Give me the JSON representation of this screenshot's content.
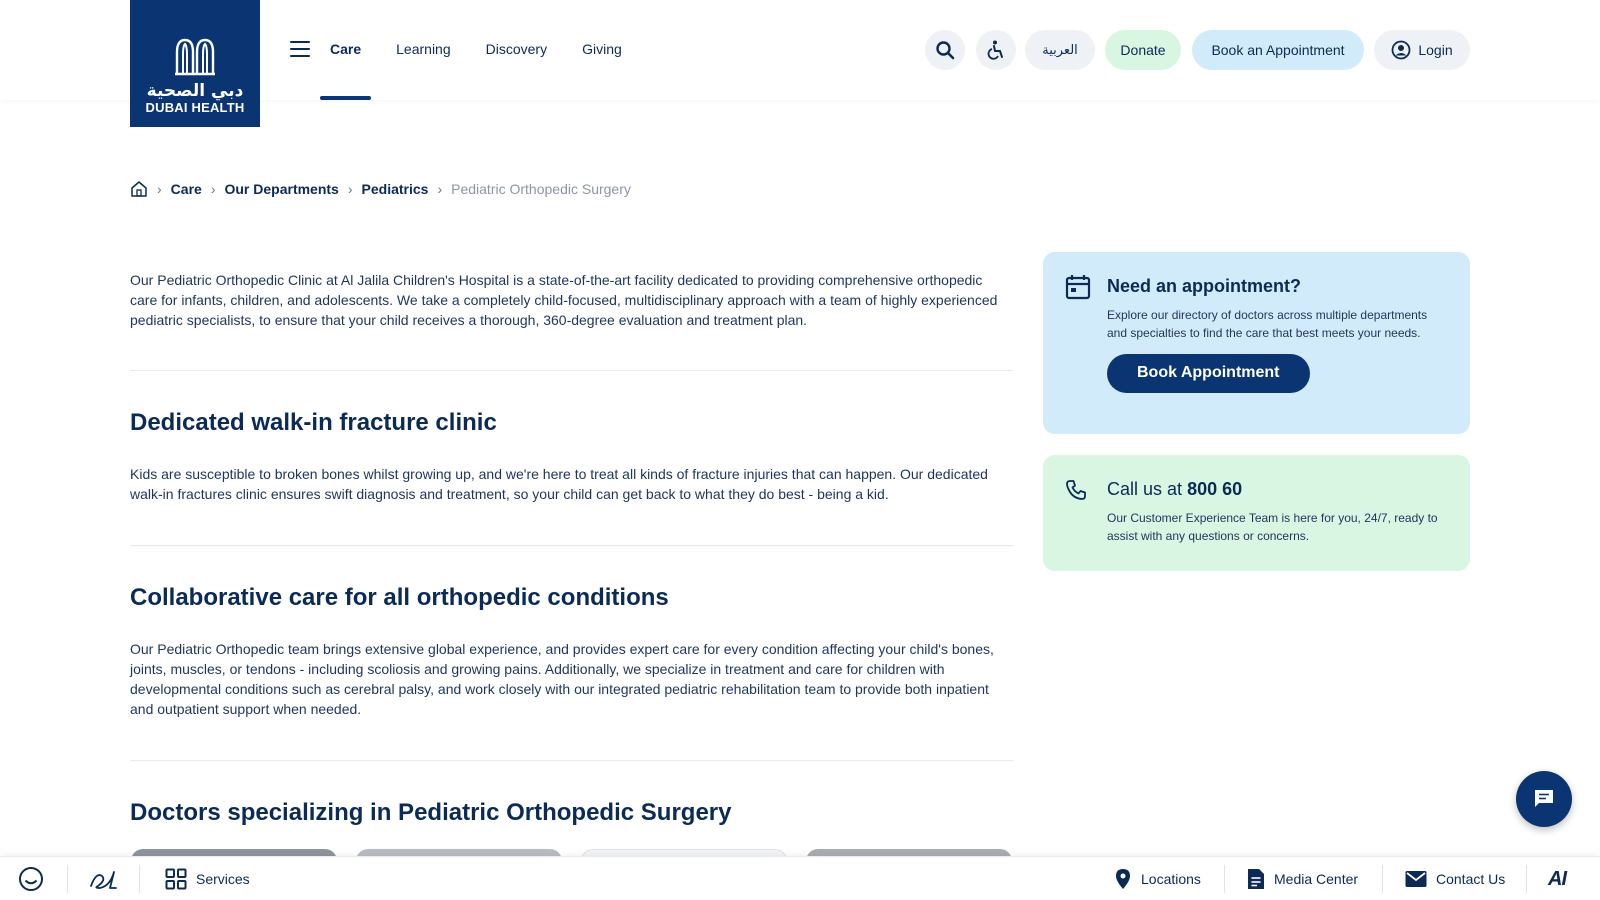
{
  "header": {
    "logo": {
      "arabic": "دبي الصحية",
      "english": "DUBAI HEALTH"
    },
    "nav": [
      {
        "label": "Care",
        "active": true
      },
      {
        "label": "Learning",
        "active": false
      },
      {
        "label": "Discovery",
        "active": false
      },
      {
        "label": "Giving",
        "active": false
      }
    ],
    "arabic_label": "العربية",
    "donate_label": "Donate",
    "book_label": "Book an Appointment",
    "login_label": "Login"
  },
  "breadcrumb": {
    "items": [
      "Care",
      "Our Departments",
      "Pediatrics"
    ],
    "current": "Pediatric Orthopedic Surgery"
  },
  "main": {
    "intro": "Our Pediatric Orthopedic Clinic at Al Jalila Children's Hospital is a state-of-the-art facility dedicated to providing comprehensive orthopedic care for infants, children, and adolescents. We take a completely child-focused, multidisciplinary approach with a team of highly experienced pediatric specialists, to ensure that your child receives a thorough, 360-degree evaluation and treatment plan.",
    "sections": [
      {
        "title": "Dedicated walk-in fracture clinic",
        "text": "Kids are susceptible to broken bones whilst growing up, and we're here to treat all kinds of fracture injuries that can happen. Our dedicated walk-in fractures clinic ensures swift diagnosis and treatment, so your child can get back to what they do best - being a kid."
      },
      {
        "title": "Collaborative care for all orthopedic conditions",
        "text": "Our Pediatric Orthopedic team brings extensive global experience, and provides expert care for every condition affecting your child's bones, joints, muscles, or tendons - including scoliosis and growing pains. Additionally, we specialize in treatment and care for children with developmental conditions such as cerebral palsy, and work closely with our integrated pediatric rehabilitation team to provide both inpatient and outpatient support when needed."
      }
    ],
    "doctors_title": "Doctors specializing in Pediatric Orthopedic Surgery"
  },
  "sidebar": {
    "appointment": {
      "title": "Need an appointment?",
      "text": "Explore our directory of doctors across multiple departments and specialties to find the care that best meets your needs.",
      "button": "Book Appointment"
    },
    "call": {
      "prefix": "Call us at",
      "number": "800 60",
      "text": "Our Customer Experience Team is here for you, 24/7, ready to assist with any questions or concerns."
    }
  },
  "bottombar": {
    "services": "Services",
    "locations": "Locations",
    "media_center": "Media Center",
    "contact_us": "Contact Us",
    "ai_label": "AI"
  },
  "colors": {
    "brand_navy": "#0b3472",
    "text_navy": "#0b2a55",
    "light_blue": "#d2ebfa",
    "light_green": "#d8f6e1",
    "muted": "#8b95a6"
  },
  "icons": [
    "menu-icon",
    "search-icon",
    "accessibility-icon",
    "user-icon",
    "home-icon",
    "calendar-icon",
    "phone-icon",
    "chat-icon",
    "smile-icon",
    "signature-icon",
    "grid-icon",
    "location-pin-icon",
    "document-icon",
    "mail-icon"
  ]
}
